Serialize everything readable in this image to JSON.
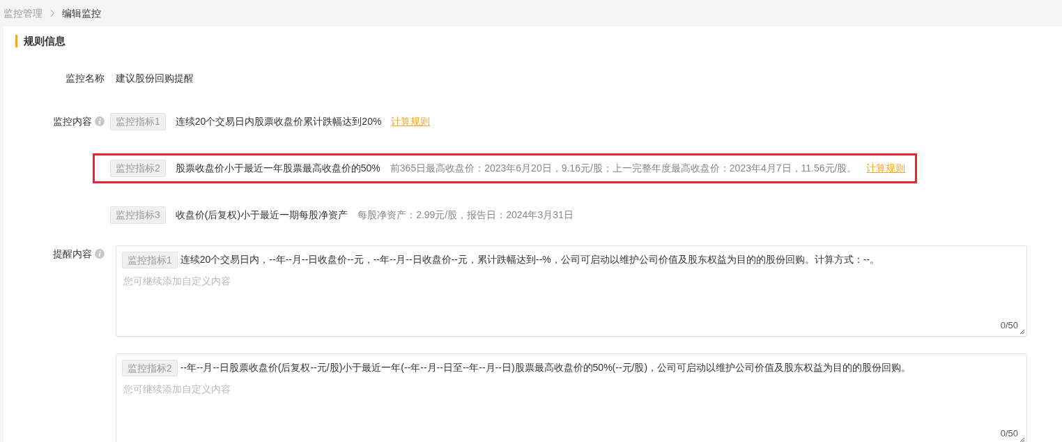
{
  "breadcrumb": [
    {
      "label": "监控管理",
      "current": false
    },
    {
      "label": "编辑监控",
      "current": true
    }
  ],
  "section_title": "规则信息",
  "monitor_name": {
    "label": "监控名称",
    "value": "建议股份回购提醒"
  },
  "monitor_content": {
    "label": "监控内容",
    "indicators": [
      {
        "tag": "监控指标1",
        "text": "连续20个交易日内股票收盘价累计跌幅达到20%",
        "link": "计算规则",
        "highlighted": false
      },
      {
        "tag": "监控指标2",
        "text": "股票收盘价小于最近一年股票最高收盘价的50%",
        "note": "前365日最高收盘价：2023年6月20日，9.16元/股；上一完整年度最高收盘价：2023年4月7日，11.56元/股。",
        "link": "计算规则",
        "highlighted": true
      },
      {
        "tag": "监控指标3",
        "text": "收盘价(后复权)小于最近一期每股净资产",
        "note": "每股净资产：2.99元/股，报告日：2024年3月31日",
        "highlighted": false
      }
    ]
  },
  "reminder_content": {
    "label": "提醒内容",
    "editors": [
      {
        "tag": "监控指标1",
        "text": "连续20个交易日内，--年--月--日收盘价--元，--年--月--日收盘价--元，累计跌幅达到--%，公司可启动以维护公司价值及股东权益为目的的股份回购。计算方式：--。",
        "placeholder": "您可继续添加自定义内容",
        "counter": "0/50"
      },
      {
        "tag": "监控指标2",
        "text": "--年--月--日股票收盘价(后复权--元/股)小于最近一年(--年--月--日至--年--月--日)股票最高收盘价的50%(--元/股)，公司可启动以维护公司价值及股东权益为目的的股份回购。",
        "placeholder": "您可继续添加自定义内容",
        "counter": "0/50"
      }
    ]
  }
}
